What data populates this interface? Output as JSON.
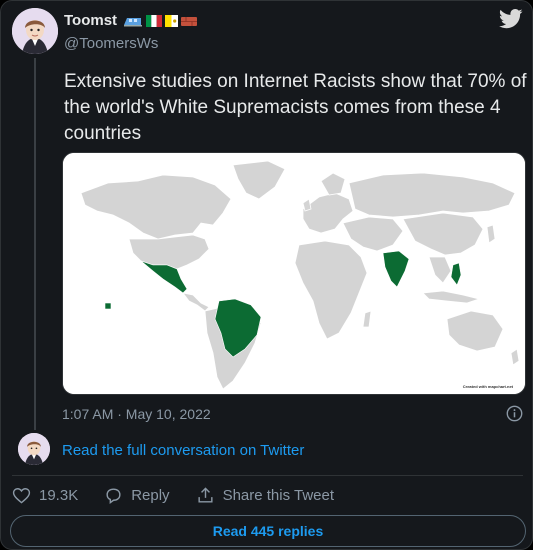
{
  "author": {
    "display_name": "Toomst",
    "handle": "@ToomersWs",
    "emoji_icons": [
      "train-icon",
      "italy-flag-icon",
      "vatican-flag-icon",
      "brick-icon"
    ]
  },
  "tweet": {
    "text": "Extensive studies on Internet Racists show that 70% of the world's White Supremacists comes from these 4 countries",
    "timestamp": "1:07 AM · May 10, 2022",
    "image": {
      "alt": "World map highlighting four countries",
      "credit": "Created with mapchart.net",
      "highlight_color": "#0c6b33",
      "land_color": "#d4d4d4",
      "highlighted_countries": [
        "Mexico",
        "Brazil",
        "India",
        "Philippines"
      ]
    }
  },
  "conversation_link": "Read the full conversation on Twitter",
  "actions": {
    "likes": "19.3K",
    "reply": "Reply",
    "share": "Share this Tweet"
  },
  "read_replies": "Read 445 replies",
  "colors": {
    "accent": "#1d9bf0",
    "background": "#15181c",
    "muted": "#8b98a5"
  }
}
